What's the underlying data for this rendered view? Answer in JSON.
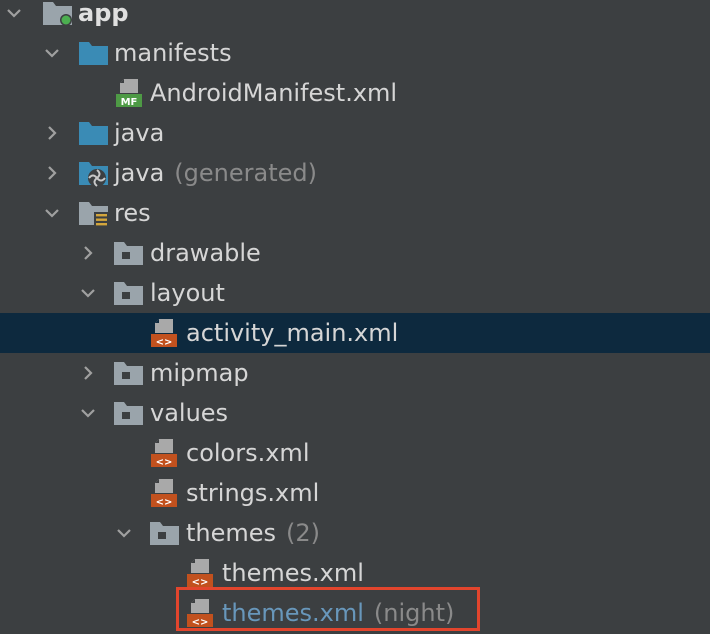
{
  "colors": {
    "background": "#3c3f41",
    "selected_row": "#0d293e",
    "folder_blue": "#3a8bb5",
    "folder_gray": "#9aa4ab",
    "xml_badge": "#c2511e",
    "highlight_box": "#e2452d",
    "text": "#d6d6d6",
    "muted_text": "#8a8a8a",
    "link_text": "#6897bb"
  },
  "tree": [
    {
      "label": "app",
      "suffix": "",
      "expanded": true,
      "icon": "module-folder-icon"
    },
    {
      "label": "manifests",
      "suffix": "",
      "expanded": true,
      "icon": "folder-icon"
    },
    {
      "label": "AndroidManifest.xml",
      "suffix": "",
      "icon": "manifest-file-icon",
      "badge": "MF"
    },
    {
      "label": "java",
      "suffix": "",
      "expanded": false,
      "icon": "folder-icon"
    },
    {
      "label": "java",
      "suffix": "(generated)",
      "expanded": false,
      "icon": "generated-folder-icon"
    },
    {
      "label": "res",
      "suffix": "",
      "expanded": true,
      "icon": "resource-folder-icon"
    },
    {
      "label": "drawable",
      "suffix": "",
      "expanded": false,
      "icon": "folder-icon"
    },
    {
      "label": "layout",
      "suffix": "",
      "expanded": true,
      "icon": "folder-icon"
    },
    {
      "label": "activity_main.xml",
      "suffix": "",
      "selected": true,
      "icon": "xml-file-icon",
      "badge": "<>"
    },
    {
      "label": "mipmap",
      "suffix": "",
      "expanded": false,
      "icon": "folder-icon"
    },
    {
      "label": "values",
      "suffix": "",
      "expanded": true,
      "icon": "folder-icon"
    },
    {
      "label": "colors.xml",
      "suffix": "",
      "icon": "xml-file-icon",
      "badge": "<>"
    },
    {
      "label": "strings.xml",
      "suffix": "",
      "icon": "xml-file-icon",
      "badge": "<>"
    },
    {
      "label": "themes",
      "suffix": "(2)",
      "expanded": true,
      "icon": "folder-icon"
    },
    {
      "label": "themes.xml",
      "suffix": "",
      "icon": "xml-file-icon",
      "badge": "<>"
    },
    {
      "label": "themes.xml",
      "suffix": "(night)",
      "highlighted": true,
      "icon": "xml-file-icon",
      "badge": "<>"
    }
  ]
}
